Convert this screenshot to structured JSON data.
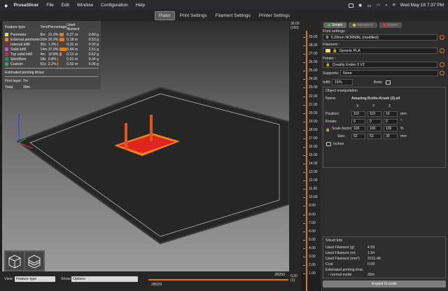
{
  "menubar": {
    "app": "PrusaSlicer",
    "items": [
      "File",
      "Edit",
      "Window",
      "Configuration",
      "Help"
    ],
    "datetime": "Wed May 18  7:37 PM"
  },
  "tabs": [
    "Plater",
    "Print Settings",
    "Filament Settings",
    "Printer Settings"
  ],
  "legend": {
    "headers": [
      "Feature type",
      "Time",
      "Percentage",
      "Used filament"
    ],
    "rows": [
      {
        "name": "Perimeter",
        "time": "8m",
        "pct": "21.0%",
        "pct_value": 21.0,
        "len": "0.27 m",
        "wt": "0.80 g",
        "color": "#f5e01a"
      },
      {
        "name": "External perimeter",
        "time": "10m",
        "pct": "26.9%",
        "pct_value": 26.9,
        "len": "0.18 m",
        "wt": "0.53 g",
        "color": "#f07f20"
      },
      {
        "name": "Internal infill",
        "time": "30s",
        "pct": "1.3%",
        "pct_value": 1.3,
        "len": "0.01 m",
        "wt": "0.02 g",
        "color": "#b01d1d"
      },
      {
        "name": "Solid infill",
        "time": "14m",
        "pct": "37.0%",
        "pct_value": 37.0,
        "len": "0.84 m",
        "wt": "2.51 g",
        "color": "#c94bd1"
      },
      {
        "name": "Top solid infill",
        "time": "4m",
        "pct": "10.8%",
        "pct_value": 10.8,
        "len": "0.21 m",
        "wt": "0.62 g",
        "color": "#e0241e"
      },
      {
        "name": "Skirt/Brim",
        "time": "18s",
        "pct": "0.8%",
        "pct_value": 0.8,
        "len": "0.01 m",
        "wt": "0.04 g",
        "color": "#0f8f74"
      },
      {
        "name": "Custom",
        "time": "51s",
        "pct": "2.2%",
        "pct_value": 2.2,
        "len": "0.02 m",
        "wt": "0.06 g",
        "color": "#3b9c6e"
      }
    ],
    "estimated_label": "Estimated printing times:",
    "first_layer": "First layer: 7m",
    "total_label": "Total:",
    "total_value": "39m"
  },
  "bottom": {
    "view_label": "View",
    "view_value": "Feature type",
    "show_label": "Show",
    "show_value": "Options",
    "slider_left": "28029",
    "slider_right": "28250"
  },
  "vslider": {
    "top_value": "30.00",
    "top_layer": "(150)",
    "bottom_value": "0.20",
    "bottom_layer": "(1)",
    "ticks": [
      "29.00",
      "28.00",
      "27.00",
      "26.00",
      "25.00",
      "24.00",
      "23.00",
      "22.00",
      "21.00",
      "20.00",
      "19.00",
      "18.00",
      "17.00",
      "16.00",
      "15.00",
      "14.00",
      "13.00",
      "12.00",
      "11.00",
      "10.00",
      "9.00",
      "8.00",
      "7.00",
      "6.00",
      "5.00",
      "4.00",
      "3.00",
      "2.00",
      "1.00"
    ]
  },
  "panel": {
    "modes": [
      "Simple",
      "Advanced",
      "Expert"
    ],
    "print_settings_label": "Print settings :",
    "print_settings_value": "0.20mm NORMAL (modified)",
    "filament_label": "Filament :",
    "filament_value": "Generic PLA",
    "printer_label": "Printer :",
    "printer_value": "Creality Ender-3 V2",
    "supports_label": "Supports:",
    "supports_value": "None",
    "infill_label": "Infill:",
    "infill_value": "15%",
    "brim_label": "Brim:",
    "om_title": "Object manipulation",
    "name_label": "Name:",
    "name_value": "Amazing Rottle-Kruek (2).stl",
    "axes": [
      "X",
      "Y",
      "Z"
    ],
    "position_label": "Position:",
    "position": [
      "110",
      "110",
      "16"
    ],
    "rotate_label": "Rotate:",
    "rotate": [
      "0",
      "0",
      "0"
    ],
    "scale_label": "Scale factors:",
    "scale": [
      "100",
      "100",
      "100"
    ],
    "size_label": "Size:",
    "size": [
      "53",
      "53",
      "30"
    ],
    "unit_mm": "mm",
    "unit_deg": "°",
    "unit_pct": "%",
    "inches_label": "Inches",
    "sliced_title": "Sliced Info",
    "sliced": [
      {
        "label": "Used Filament (g)",
        "value": "4.59"
      },
      {
        "label": "Used Filament (m)",
        "value": "1.54"
      },
      {
        "label": "Used Filament (mm³)",
        "value": "3701.48"
      },
      {
        "label": "Cost",
        "value": "0.09"
      }
    ],
    "est_time_label": "Estimated printing time:",
    "normal_mode_label": "- normal mode",
    "normal_mode_value": "39m",
    "export_label": "Export G-code"
  },
  "colors": {
    "accent": "#e07a1e",
    "plate": "#2b2b2b",
    "model_red": "#e0241e",
    "model_orange": "#f07f20"
  }
}
